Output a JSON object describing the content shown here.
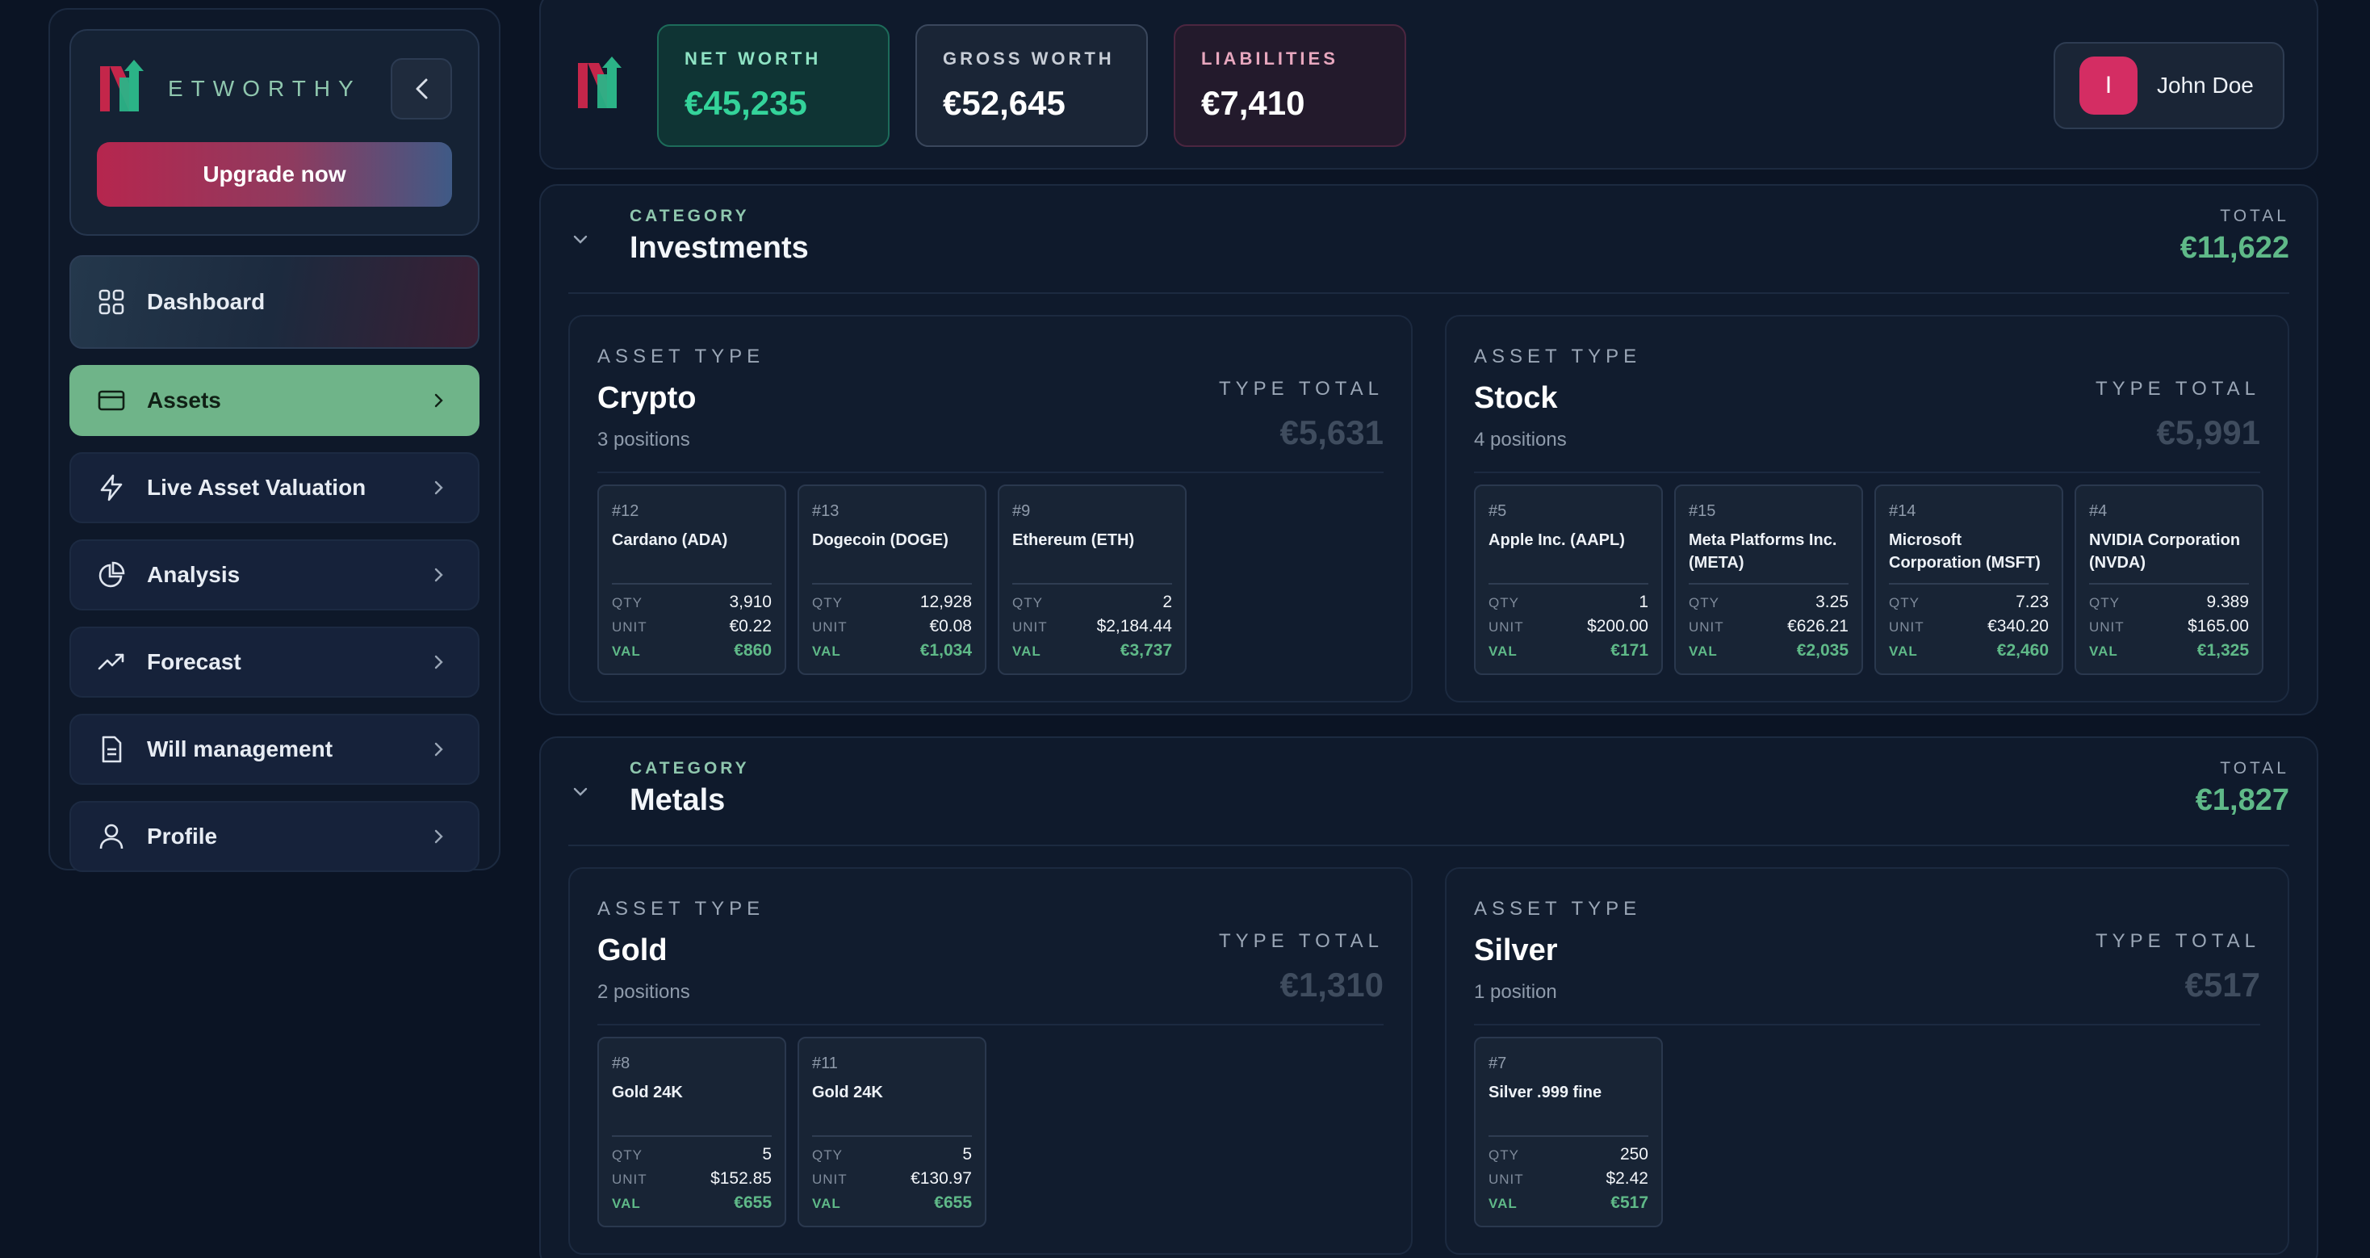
{
  "brand": {
    "name": "ETWORTHY",
    "upgrade_label": "Upgrade now"
  },
  "nav": [
    {
      "label": "Dashboard",
      "icon": "grid-icon"
    },
    {
      "label": "Assets",
      "icon": "card-icon"
    },
    {
      "label": "Live Asset Valuation",
      "icon": "bolt-icon"
    },
    {
      "label": "Analysis",
      "icon": "pie-chart-icon"
    },
    {
      "label": "Forecast",
      "icon": "trend-up-icon"
    },
    {
      "label": "Will management",
      "icon": "document-icon"
    },
    {
      "label": "Profile",
      "icon": "user-icon"
    }
  ],
  "metrics": {
    "net": {
      "label": "NET WORTH",
      "value": "€45,235"
    },
    "gross": {
      "label": "GROSS WORTH",
      "value": "€52,645"
    },
    "liab": {
      "label": "LIABILITIES",
      "value": "€7,410"
    }
  },
  "user": {
    "initial": "I",
    "name": "John Doe"
  },
  "labels": {
    "category": "CATEGORY",
    "total": "TOTAL",
    "asset_type": "ASSET TYPE",
    "type_total": "TYPE TOTAL",
    "qty": "QTY",
    "unit": "UNIT",
    "val": "VAL"
  },
  "categories": [
    {
      "title": "Investments",
      "total": "€11,622",
      "types": [
        {
          "title": "Crypto",
          "count": "3 positions",
          "total": "€5,631",
          "positions": [
            {
              "id": "#12",
              "name": "Cardano (ADA)",
              "qty": "3,910",
              "unit": "€0.22",
              "val": "€860"
            },
            {
              "id": "#13",
              "name": "Dogecoin (DOGE)",
              "qty": "12,928",
              "unit": "€0.08",
              "val": "€1,034"
            },
            {
              "id": "#9",
              "name": "Ethereum (ETH)",
              "qty": "2",
              "unit": "$2,184.44",
              "val": "€3,737"
            }
          ]
        },
        {
          "title": "Stock",
          "count": "4 positions",
          "total": "€5,991",
          "positions": [
            {
              "id": "#5",
              "name": "Apple Inc. (AAPL)",
              "qty": "1",
              "unit": "$200.00",
              "val": "€171"
            },
            {
              "id": "#15",
              "name": "Meta Platforms Inc. (META)",
              "qty": "3.25",
              "unit": "€626.21",
              "val": "€2,035"
            },
            {
              "id": "#14",
              "name": "Microsoft Corporation (MSFT)",
              "qty": "7.23",
              "unit": "€340.20",
              "val": "€2,460"
            },
            {
              "id": "#4",
              "name": "NVIDIA Corporation (NVDA)",
              "qty": "9.389",
              "unit": "$165.00",
              "val": "€1,325"
            }
          ]
        }
      ]
    },
    {
      "title": "Metals",
      "total": "€1,827",
      "types": [
        {
          "title": "Gold",
          "count": "2 positions",
          "total": "€1,310",
          "positions": [
            {
              "id": "#8",
              "name": "Gold 24K",
              "qty": "5",
              "unit": "$152.85",
              "val": "€655"
            },
            {
              "id": "#11",
              "name": "Gold 24K",
              "qty": "5",
              "unit": "€130.97",
              "val": "€655"
            }
          ]
        },
        {
          "title": "Silver",
          "count": "1 position",
          "total": "€517",
          "positions": [
            {
              "id": "#7",
              "name": "Silver .999 fine",
              "qty": "250",
              "unit": "$2.42",
              "val": "€517"
            }
          ]
        }
      ]
    }
  ]
}
